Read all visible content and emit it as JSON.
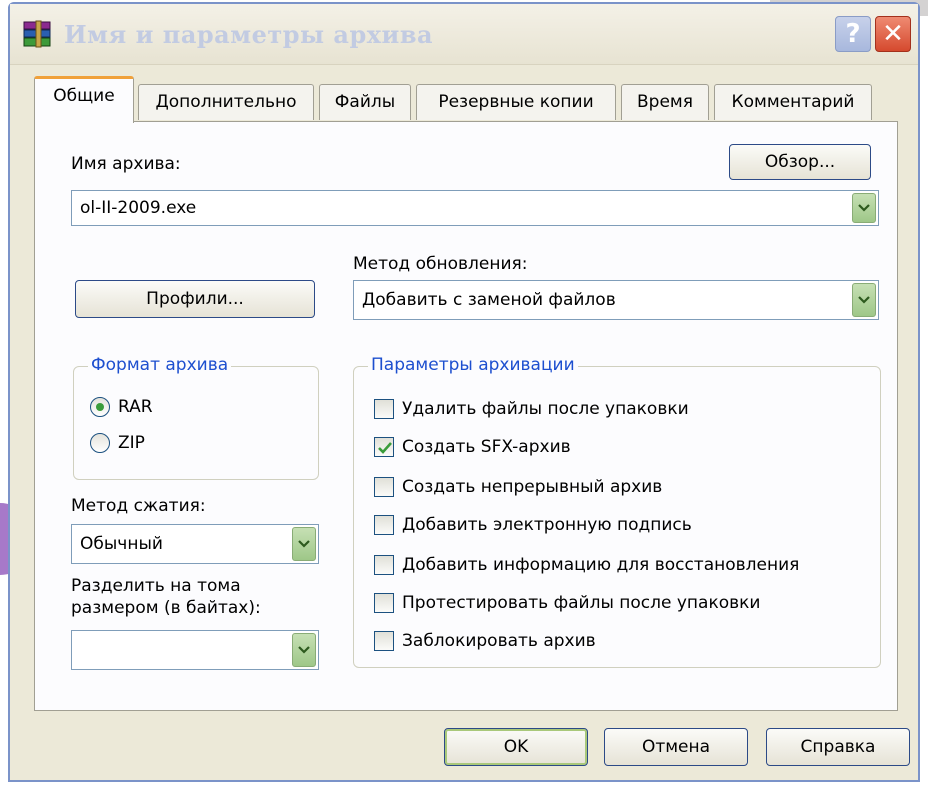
{
  "window": {
    "title": "Имя и параметры архива"
  },
  "titlebar": {
    "help_label": "?",
    "close_label": "✕"
  },
  "tabs": [
    {
      "label": "Общие",
      "active": true
    },
    {
      "label": "Дополнительно",
      "active": false
    },
    {
      "label": "Файлы",
      "active": false
    },
    {
      "label": "Резервные копии",
      "active": false
    },
    {
      "label": "Время",
      "active": false
    },
    {
      "label": "Комментарий",
      "active": false
    }
  ],
  "archive_name": {
    "label": "Имя архива:",
    "value": "ol-II-2009.exe",
    "browse_label": "Обзор..."
  },
  "profiles": {
    "label": "Профили..."
  },
  "update_method": {
    "label": "Метод обновления:",
    "value": "Добавить с заменой файлов"
  },
  "format": {
    "title": "Формат архива",
    "options": [
      {
        "label": "RAR",
        "selected": true
      },
      {
        "label": "ZIP",
        "selected": false
      }
    ]
  },
  "compression": {
    "label": "Метод сжатия:",
    "value": "Обычный"
  },
  "split": {
    "label_line1": "Разделить на тома",
    "label_line2": "размером (в байтах):",
    "value": ""
  },
  "archive_options": {
    "title": "Параметры архивации",
    "items": [
      {
        "label": "Удалить файлы после упаковки",
        "checked": false
      },
      {
        "label": "Создать SFX-архив",
        "checked": true
      },
      {
        "label": "Создать непрерывный архив",
        "checked": false
      },
      {
        "label": "Добавить электронную подпись",
        "checked": false
      },
      {
        "label": "Добавить информацию для восстановления",
        "checked": false
      },
      {
        "label": "Протестировать файлы после упаковки",
        "checked": false
      },
      {
        "label": "Заблокировать архив",
        "checked": false
      }
    ]
  },
  "buttons": {
    "ok": "OK",
    "cancel": "Отмена",
    "help": "Справка"
  },
  "colors": {
    "accent_tab": "#f0a13a",
    "group_title": "#1d4fcf",
    "check_green": "#3a9c3a"
  }
}
